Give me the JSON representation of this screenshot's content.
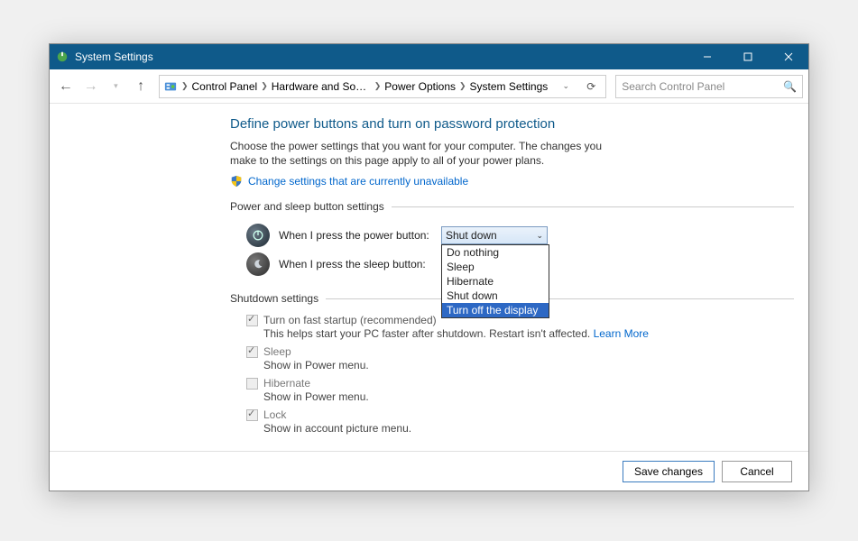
{
  "window": {
    "title": "System Settings"
  },
  "breadcrumb": [
    "Control Panel",
    "Hardware and Sound",
    "Power Options",
    "System Settings"
  ],
  "search": {
    "placeholder": "Search Control Panel"
  },
  "page": {
    "title": "Define power buttons and turn on password protection",
    "description": "Choose the power settings that you want for your computer. The changes you make to the settings on this page apply to all of your power plans.",
    "uac_link": "Change settings that are currently unavailable"
  },
  "groups": {
    "power_sleep": "Power and sleep button settings",
    "shutdown": "Shutdown settings"
  },
  "rows": {
    "power_btn": {
      "label": "When I press the power button:",
      "value": "Shut down"
    },
    "sleep_btn": {
      "label": "When I press the sleep button:"
    }
  },
  "dropdown_options": [
    "Do nothing",
    "Sleep",
    "Hibernate",
    "Shut down",
    "Turn off the display"
  ],
  "dropdown_selected_index": 4,
  "shutdown_items": [
    {
      "label": "Turn on fast startup (recommended)",
      "sub": "This helps start your PC faster after shutdown. Restart isn't affected.",
      "learn_more": "Learn More",
      "checked": true
    },
    {
      "label": "Sleep",
      "sub": "Show in Power menu.",
      "checked": true
    },
    {
      "label": "Hibernate",
      "sub": "Show in Power menu.",
      "checked": false
    },
    {
      "label": "Lock",
      "sub": "Show in account picture menu.",
      "checked": true
    }
  ],
  "buttons": {
    "save": "Save changes",
    "cancel": "Cancel"
  }
}
